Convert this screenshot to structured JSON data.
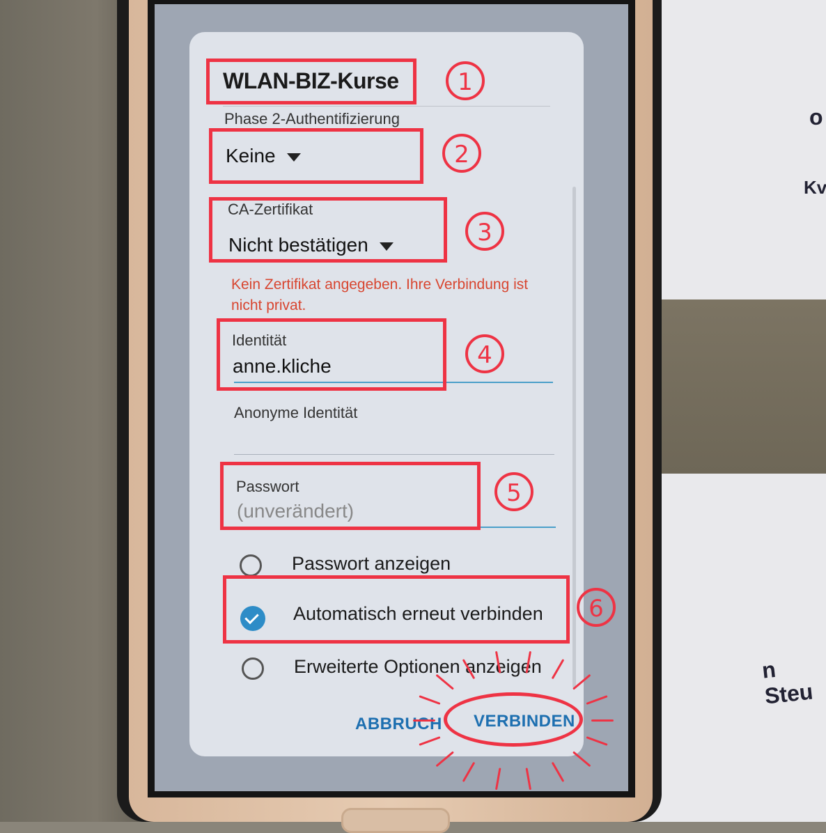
{
  "dialog": {
    "title": "WLAN-BIZ-Kurse",
    "phase2": {
      "label": "Phase 2-Authentifizierung",
      "value": "Keine"
    },
    "ca_cert": {
      "label": "CA-Zertifikat",
      "value": "Nicht bestätigen"
    },
    "warning": "Kein Zertifikat angegeben. Ihre Verbindung ist nicht privat.",
    "identity": {
      "label": "Identität",
      "value": "anne.kliche"
    },
    "anon_identity": {
      "label": "Anonyme Identität",
      "value": ""
    },
    "password": {
      "label": "Passwort",
      "placeholder": "(unverändert)"
    },
    "options": [
      {
        "label": "Passwort anzeigen",
        "checked": false
      },
      {
        "label": "Automatisch erneut verbinden",
        "checked": true
      },
      {
        "label": "Erweiterte Optionen anzeigen",
        "checked": false
      }
    ],
    "buttons": {
      "cancel": "ABBRUCH",
      "connect": "VERBINDEN"
    }
  },
  "annotations": {
    "numbers": [
      "1",
      "2",
      "3",
      "4",
      "5",
      "6"
    ],
    "color": "#ee3344"
  },
  "background_text": [
    "o",
    "Kv",
    "n Steu"
  ],
  "colors": {
    "accent": "#2d8cc7",
    "warning": "#d8452f",
    "button": "#1d6fb0"
  }
}
